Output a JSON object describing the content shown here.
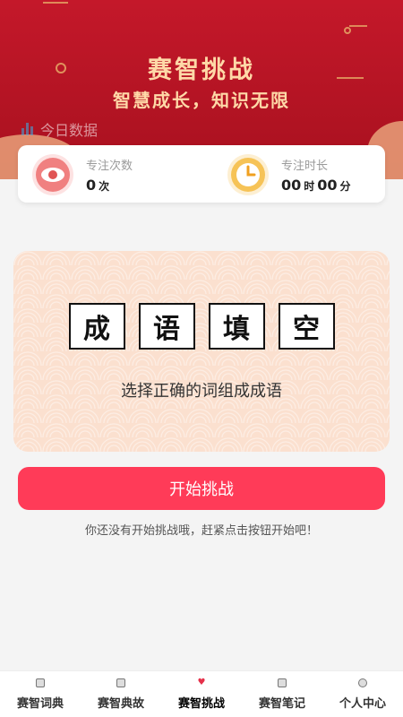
{
  "hero": {
    "title": "赛智挑战",
    "subtitle": "智慧成长，知识无限"
  },
  "today": {
    "label": "今日数据"
  },
  "stats": [
    {
      "label": "专注次数",
      "value": "0",
      "unit": "次",
      "icon": "eye-icon",
      "color": "#f06b6b"
    },
    {
      "label": "专注时长",
      "value_hours": "00",
      "unit_hours": "时",
      "value_minutes": "00",
      "unit_minutes": "分",
      "icon": "clock-icon",
      "color": "#f4b23c"
    }
  ],
  "game": {
    "chars": [
      "成",
      "语",
      "填",
      "空"
    ],
    "description": "选择正确的词组成成语"
  },
  "start_button": "开始挑战",
  "hint": "你还没有开始挑战哦，赶紧点击按钮开始吧！",
  "tabs": [
    {
      "label": "赛智词典",
      "icon": "dictionary-icon"
    },
    {
      "label": "赛智典故",
      "icon": "story-icon"
    },
    {
      "label": "赛智挑战",
      "icon": "challenge-icon",
      "active": true
    },
    {
      "label": "赛智笔记",
      "icon": "notes-icon"
    },
    {
      "label": "个人中心",
      "icon": "profile-icon"
    }
  ],
  "colors": {
    "primary": "#ff3b58",
    "hero": "#c4182a",
    "gold": "#ffd9a8"
  }
}
